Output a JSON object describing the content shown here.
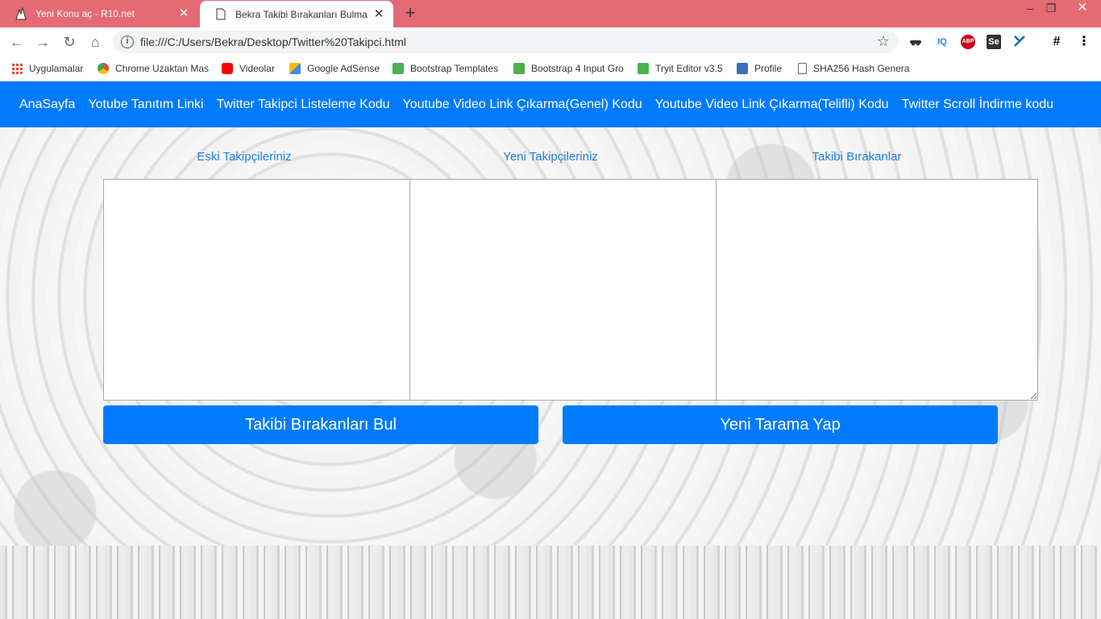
{
  "browser": {
    "tabs": [
      {
        "title": "Yeni Konu aç - R10.net",
        "active": false
      },
      {
        "title": "Bekra Takibi Bırakanları Bulma",
        "active": true
      }
    ],
    "new_tab_label": "+",
    "url": "file:///C:/Users/Bekra/Desktop/Twitter%20Takipci.html",
    "extensions": [
      "incognito-icon",
      "iq-icon",
      "abp-icon",
      "selenium-icon",
      "xpath-icon",
      "hash-icon"
    ],
    "extension_labels": {
      "iq": "IQ",
      "abp": "ABP",
      "se": "Se",
      "hash": "#"
    },
    "bookmarks": [
      {
        "label": "Uygulamalar",
        "icon": "apps-grid-icon"
      },
      {
        "label": "Chrome Uzaktan Mas",
        "icon": "chrome-remote-icon"
      },
      {
        "label": "Videolar",
        "icon": "youtube-icon"
      },
      {
        "label": "Google AdSense",
        "icon": "adsense-icon"
      },
      {
        "label": "Bootstrap Templates",
        "icon": "w3-icon"
      },
      {
        "label": "Bootstrap 4 Input Gro",
        "icon": "w3-icon"
      },
      {
        "label": "Tryit Editor v3.5",
        "icon": "w3-icon"
      },
      {
        "label": "Profile",
        "icon": "profile-icon"
      },
      {
        "label": "SHA256 Hash Genera",
        "icon": "page-icon"
      }
    ]
  },
  "nav": {
    "links": [
      "AnaSayfa",
      "Yotube Tanıtım Linki",
      "Twitter Takipci Listeleme Kodu",
      "Youtube Video Link Çıkarma(Genel) Kodu",
      "Youtube Video Link Çıkarma(Telifli) Kodu",
      "Twitter Scroll İndirme kodu"
    ]
  },
  "main": {
    "labels": {
      "old": "Eski Takipçileriniz",
      "new": "Yeni Takipçileriniz",
      "unfollowed": "Takibi Bırakanlar"
    },
    "buttons": {
      "find": "Takibi Bırakanları Bul",
      "rescan": "Yeni Tarama Yap"
    }
  },
  "colors": {
    "tabstrip": "#e46a74",
    "primary": "#007bff",
    "label": "#1e7fe6"
  }
}
